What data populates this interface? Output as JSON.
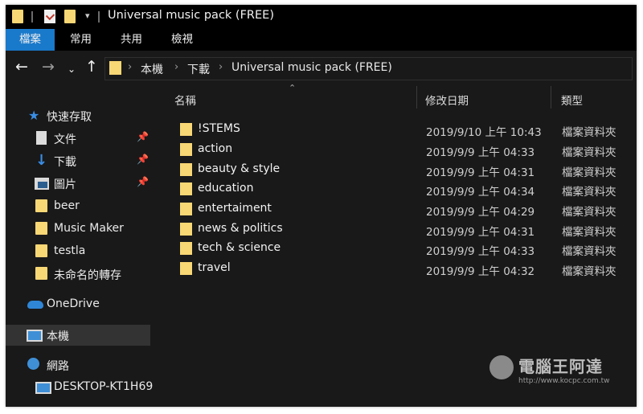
{
  "window": {
    "title": "Universal music pack (FREE)"
  },
  "ribbon": {
    "tabs": [
      "檔案",
      "常用",
      "共用",
      "檢視"
    ]
  },
  "address": {
    "crumbs": [
      "本機",
      "下載",
      "Universal music pack (FREE)"
    ]
  },
  "sidebar": {
    "items": [
      {
        "label": "快速存取",
        "icon": "star-icon"
      },
      {
        "label": "文件",
        "icon": "document-icon",
        "pinned": true
      },
      {
        "label": "下載",
        "icon": "download-icon",
        "pinned": true
      },
      {
        "label": "圖片",
        "icon": "pictures-icon",
        "pinned": true
      },
      {
        "label": "beer",
        "icon": "folder-icon"
      },
      {
        "label": "Music Maker",
        "icon": "folder-icon"
      },
      {
        "label": "testla",
        "icon": "folder-icon"
      },
      {
        "label": "未命名的轉存",
        "icon": "folder-icon"
      },
      {
        "label": "OneDrive",
        "icon": "cloud-icon"
      },
      {
        "label": "本機",
        "icon": "computer-icon",
        "selected": true
      },
      {
        "label": "網路",
        "icon": "network-icon"
      },
      {
        "label": "DESKTOP-KT1H69",
        "icon": "computer-icon"
      }
    ]
  },
  "columns": {
    "name": "名稱",
    "date": "修改日期",
    "type": "類型"
  },
  "files": [
    {
      "name": "!STEMS",
      "date": "2019/9/10 上午 10:43",
      "type": "檔案資料夾"
    },
    {
      "name": "action",
      "date": "2019/9/9 上午 04:33",
      "type": "檔案資料夾"
    },
    {
      "name": "beauty & style",
      "date": "2019/9/9 上午 04:31",
      "type": "檔案資料夾"
    },
    {
      "name": "education",
      "date": "2019/9/9 上午 04:34",
      "type": "檔案資料夾"
    },
    {
      "name": "entertaiment",
      "date": "2019/9/9 上午 04:29",
      "type": "檔案資料夾"
    },
    {
      "name": "news & politics",
      "date": "2019/9/9 上午 04:31",
      "type": "檔案資料夾"
    },
    {
      "name": "tech & science",
      "date": "2019/9/9 上午 04:33",
      "type": "檔案資料夾"
    },
    {
      "name": "travel",
      "date": "2019/9/9 上午 04:32",
      "type": "檔案資料夾"
    }
  ],
  "watermark": {
    "text": "電腦王阿達",
    "url": "http://www.kocpc.com.tw"
  },
  "colors": {
    "accent": "#1979ca",
    "folder": "#f8d775",
    "background": "#191919"
  }
}
